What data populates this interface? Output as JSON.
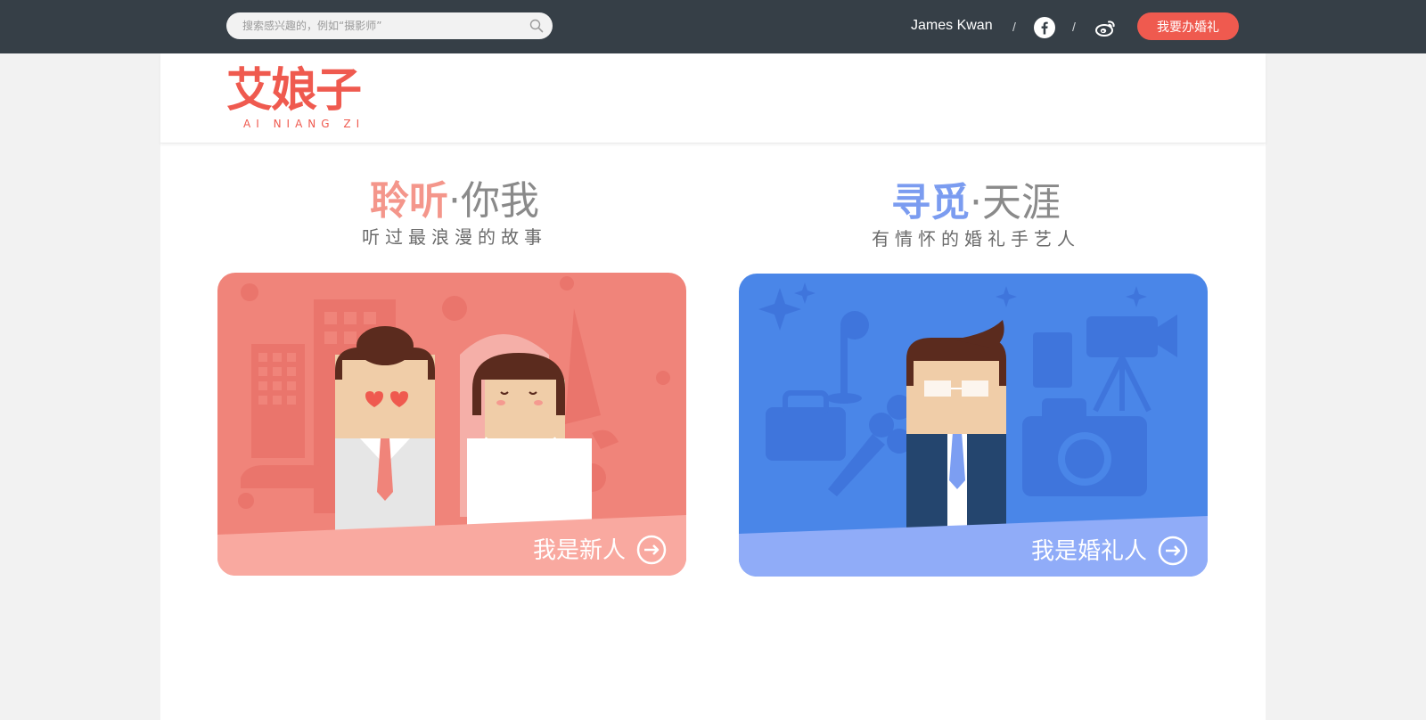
{
  "topbar": {
    "search_placeholder": "搜索感兴趣的，例如“摄影师”",
    "search_icon": "search-icon",
    "user_name": "James Kwan",
    "separator": "/",
    "facebook_icon": "facebook-icon",
    "weibo_icon": "weibo-icon",
    "cta_label": "我要办婚礼",
    "cta_color": "#ef5a4f"
  },
  "logo": {
    "cn": "艾娘子",
    "en": "AI NIANG ZI",
    "color": "#ef5a4f"
  },
  "sections": [
    {
      "title_highlight": "聆听",
      "title_dot": "·",
      "title_rest": "你我",
      "subtitle": "听过最浪漫的故事",
      "accent": "#f4968b",
      "card_label": "我是新人",
      "card_color": "#f0847a",
      "card_band": "#f9a9a0",
      "arrow_icon": "arrow-right-circle-icon"
    },
    {
      "title_highlight": "寻觅",
      "title_dot": "·",
      "title_rest": "天涯",
      "subtitle": "有情怀的婚礼手艺人",
      "accent": "#7b9cf0",
      "card_label": "我是婚礼人",
      "card_color": "#4a86e8",
      "card_band": "#90acf8",
      "arrow_icon": "arrow-right-circle-icon"
    }
  ]
}
